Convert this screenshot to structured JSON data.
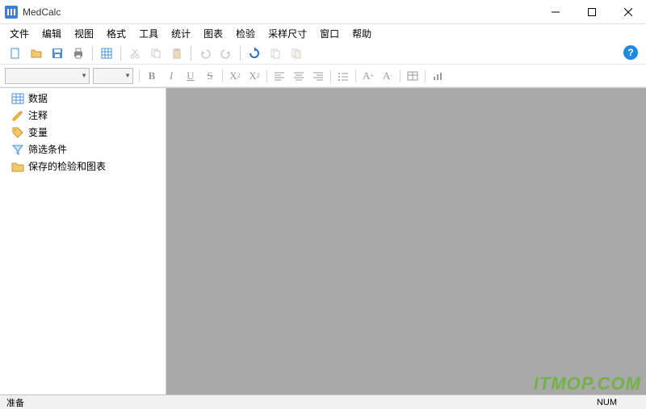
{
  "app": {
    "title": "MedCalc"
  },
  "menus": [
    "文件",
    "编辑",
    "视图",
    "格式",
    "工具",
    "统计",
    "图表",
    "检验",
    "采样尺寸",
    "窗口",
    "帮助"
  ],
  "sidebar": {
    "items": [
      {
        "label": "数据"
      },
      {
        "label": "注释"
      },
      {
        "label": "变量"
      },
      {
        "label": "筛选条件"
      },
      {
        "label": "保存的检验和图表"
      }
    ]
  },
  "status": {
    "left": "准备",
    "right": "NUM"
  },
  "watermark": "ITMOP.COM",
  "format": {
    "bold": "B",
    "italic": "I",
    "underline": "U",
    "strike": "S",
    "sub": "X",
    "sup": "X",
    "aplus": "A",
    "aminus": "A"
  },
  "subsup": {
    "sub2": "2",
    "sup2": "2",
    "plus": "+",
    "minus": "-"
  }
}
